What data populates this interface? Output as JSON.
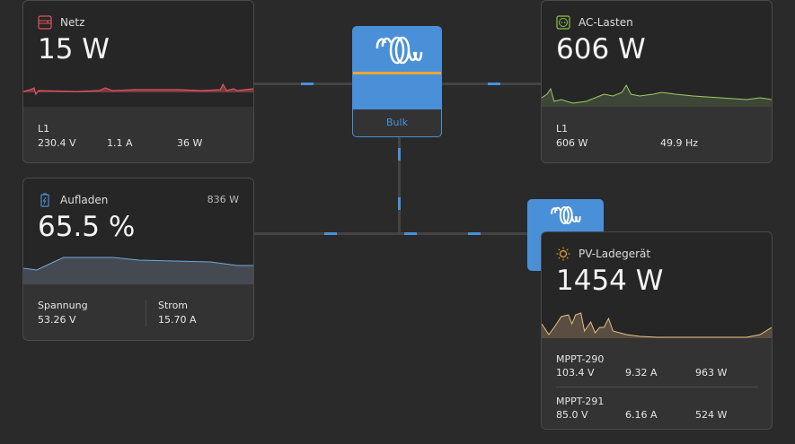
{
  "grid": {
    "title": "Netz",
    "power": "15 W",
    "phase": "L1",
    "voltage": "230.4 V",
    "current": "1.1 A",
    "watts": "36 W",
    "icon": "grid-icon",
    "color": "#e05561"
  },
  "battery": {
    "title": "Aufladen",
    "power_right": "836 W",
    "soc": "65.5 %",
    "voltage_label": "Spannung",
    "voltage": "53.26 V",
    "current_label": "Strom",
    "current": "15.70 A",
    "icon": "battery-charging-icon",
    "color": "#4a90d9"
  },
  "inverter": {
    "state": "Bulk",
    "icon": "victron-logo",
    "accent": "#f0a830"
  },
  "ac_loads": {
    "title": "AC-Lasten",
    "power": "606 W",
    "phase": "L1",
    "watts": "606 W",
    "frequency": "49.9 Hz",
    "icon": "socket-icon",
    "color": "#8bc34a"
  },
  "pv": {
    "title": "PV-Ladegerät",
    "power": "1454 W",
    "icon": "sun-icon",
    "color": "#f0a830",
    "chargers": [
      {
        "name": "MPPT-290",
        "voltage": "103.4 V",
        "current": "9.32 A",
        "watts": "963 W"
      },
      {
        "name": "MPPT-291",
        "voltage": "85.0 V",
        "current": "6.16 A",
        "watts": "524 W"
      }
    ]
  }
}
